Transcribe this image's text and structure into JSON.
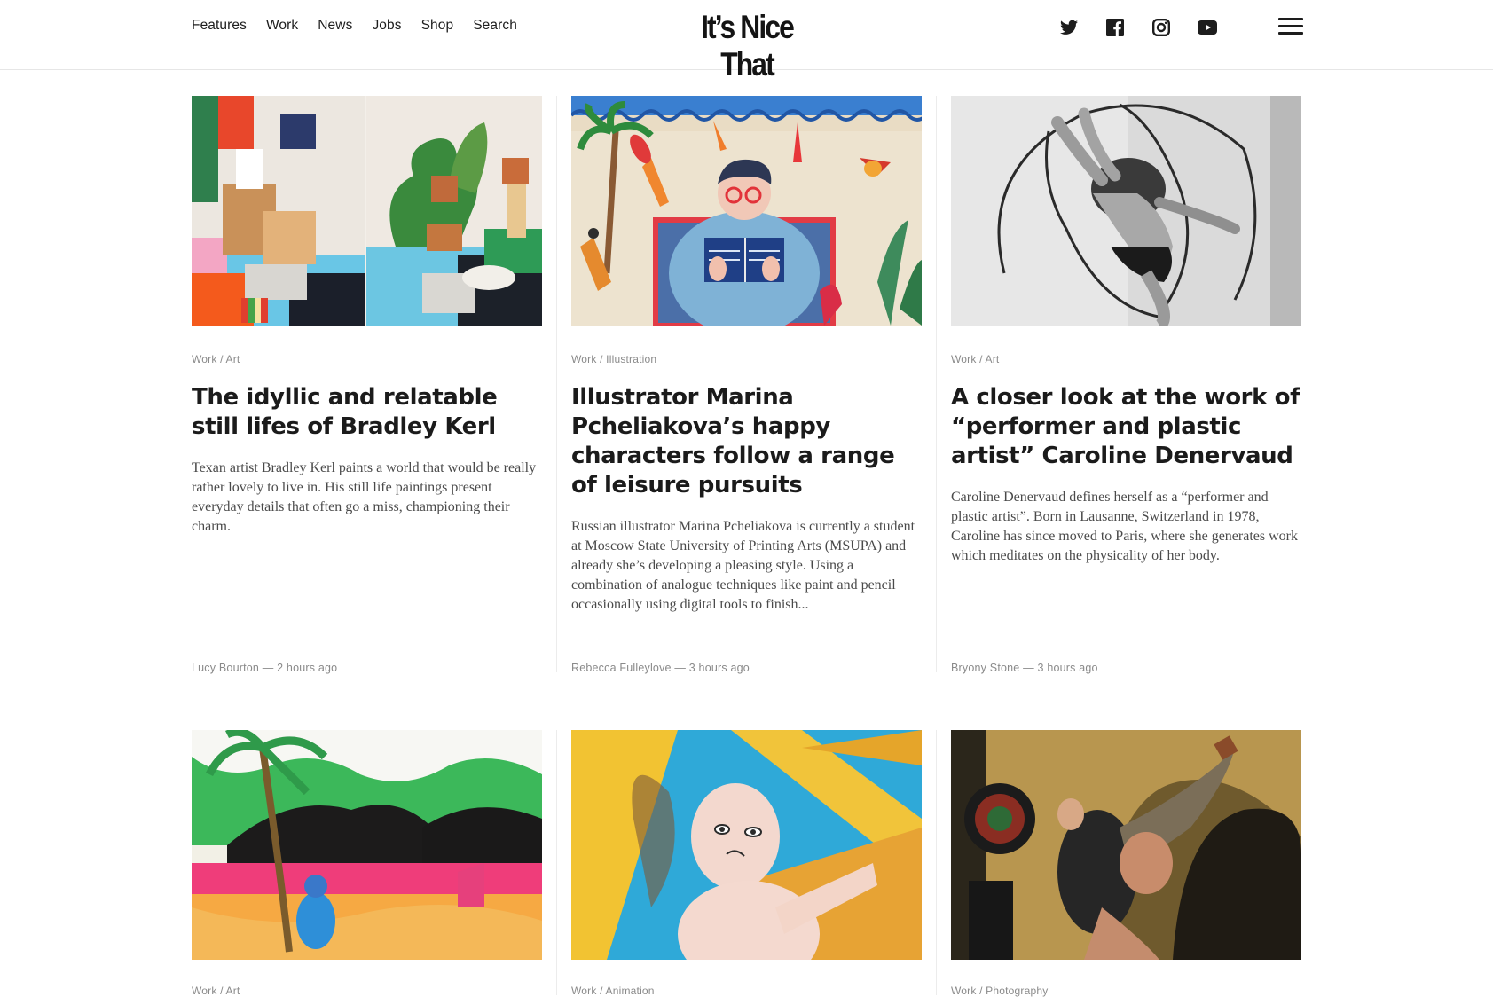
{
  "nav": {
    "items": [
      "Features",
      "Work",
      "News",
      "Jobs",
      "Shop",
      "Search"
    ]
  },
  "logo": {
    "text": "It’s Nice That"
  },
  "social": [
    "twitter-icon",
    "facebook-icon",
    "instagram-icon",
    "youtube-icon"
  ],
  "menu_icon": "hamburger-menu-icon",
  "articles": [
    {
      "category": "Work / Art",
      "title": "The idyllic and relatable still lifes of Bradley Kerl",
      "excerpt": "Texan artist Bradley Kerl paints a world that would be really rather lovely to live in. His still life paintings present everyday details that often go a miss, championing their charm.",
      "byline": "Lucy Bourton — 2 hours ago"
    },
    {
      "category": "Work / Illustration",
      "title": "Illustrator Marina Pcheliakova’s happy characters follow a range of leisure pursuits",
      "excerpt": "Russian illustrator Marina Pcheliakova is currently a student at Moscow State University of Printing Arts (MSUPA) and already she’s developing a pleasing style. Using a combination of analogue techniques like paint and pencil occasionally using digital tools to finish...",
      "byline": "Rebecca Fulleylove — 3 hours ago"
    },
    {
      "category": "Work / Art",
      "title": "A closer look at the work of “performer and plastic artist” Caroline Denervaud",
      "excerpt": "Caroline Denervaud defines herself as a “performer and plastic artist”. Born in Lausanne, Switzerland in 1978, Caroline has since moved to Paris, where she generates work which meditates on the physicality of her body.",
      "byline": "Bryony Stone — 3 hours ago"
    },
    {
      "category": "Work / Art"
    },
    {
      "category": "Work / Animation"
    },
    {
      "category": "Work / Photography"
    }
  ]
}
